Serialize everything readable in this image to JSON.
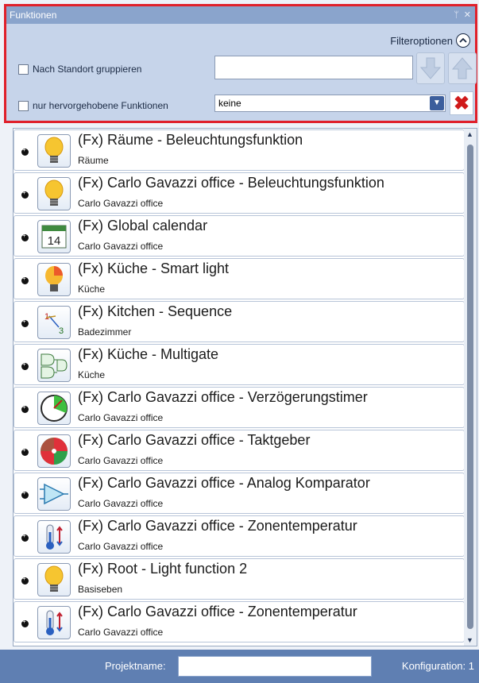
{
  "panel": {
    "title": "Funktionen",
    "pin_glyph": "ᛘ",
    "close_glyph": "✕",
    "filter_label": "Filteroptionen",
    "group_by_location_label": "Nach Standort gruppieren",
    "highlighted_only_label": "nur hervorgehobene Funktionen",
    "search_value": "",
    "select_value": "keine",
    "clear_glyph": "✖"
  },
  "items": [
    {
      "title": "(Fx) Räume - Beleuchtungsfunktion",
      "subtitle": "Räume",
      "icon": "lightbulb-icon"
    },
    {
      "title": "(Fx) Carlo Gavazzi office - Beleuchtungsfunktion",
      "subtitle": "Carlo Gavazzi office",
      "icon": "lightbulb-icon"
    },
    {
      "title": "(Fx) Global calendar",
      "subtitle": "Carlo Gavazzi office",
      "icon": "calendar-icon",
      "icon_text": "14"
    },
    {
      "title": "(Fx) Küche - Smart light",
      "subtitle": "Küche",
      "icon": "smart-light-icon"
    },
    {
      "title": "(Fx) Kitchen - Sequence",
      "subtitle": "Badezimmer",
      "icon": "sequence-icon",
      "icon_text": "1·3"
    },
    {
      "title": "(Fx) Küche - Multigate",
      "subtitle": "Küche",
      "icon": "logic-gate-icon"
    },
    {
      "title": "(Fx) Carlo Gavazzi office - Verzögerungstimer",
      "subtitle": "Carlo Gavazzi office",
      "icon": "clock-icon"
    },
    {
      "title": "(Fx) Carlo Gavazzi office - Taktgeber",
      "subtitle": "Carlo Gavazzi office",
      "icon": "pulse-wheel-icon"
    },
    {
      "title": "(Fx) Carlo Gavazzi office - Analog Komparator",
      "subtitle": "Carlo Gavazzi office",
      "icon": "comparator-icon"
    },
    {
      "title": "(Fx) Carlo Gavazzi office - Zonentemperatur",
      "subtitle": "Carlo Gavazzi office",
      "icon": "thermometer-icon"
    },
    {
      "title": "(Fx) Root - Light function 2",
      "subtitle": "Basiseben",
      "icon": "lightbulb-icon"
    },
    {
      "title": "(Fx) Carlo Gavazzi office - Zonentemperatur",
      "subtitle": "Carlo Gavazzi office",
      "icon": "thermometer-icon"
    }
  ],
  "statusbar": {
    "project_label": "Projektname:",
    "project_value": "",
    "configuration": "Konfiguration: 1"
  }
}
